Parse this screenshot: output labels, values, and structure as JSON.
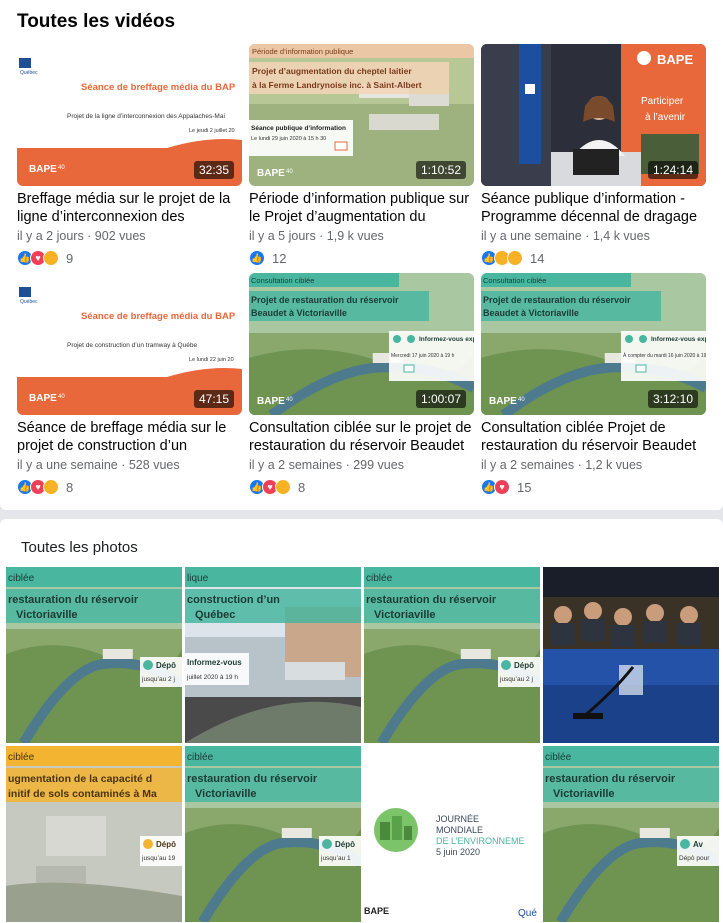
{
  "videos_section": {
    "title": "Toutes les vidéos"
  },
  "videos": [
    {
      "thumb": "briefing",
      "thumb_title": "Séance de breffage média du BAP",
      "thumb_sub": "Projet de la ligne d’interconnexion des Appalaches-Mai",
      "thumb_date": "Le jeudi 2 juillet 20",
      "duration": "32:35",
      "title": "Breffage média sur le projet de la ligne d’interconnexion des Appalaches-…",
      "meta": "il y a 2 jours · 902 vues",
      "reactions": [
        "like",
        "love",
        "care"
      ],
      "count": "9"
    },
    {
      "thumb": "farm",
      "thumb_banner": "Période d’information publique",
      "thumb_title": "Projet d’augmentation du cheptel laitier à la Ferme Landrynoise inc. à Saint-Albert",
      "thumb_sub": "Séance publique d’information",
      "thumb_date": "Le lundi 29 juin 2020 à 15 h 30",
      "duration": "1:10:52",
      "title": "Période d’information publique sur le Projet d’augmentation du cheptel lait…",
      "meta": "il y a 5 jours · 1,9 k vues",
      "reactions": [
        "like"
      ],
      "count": "12"
    },
    {
      "thumb": "speaker",
      "thumb_brand": "BAPE",
      "thumb_title": "Participer à l’avenir",
      "duration": "1:24:14",
      "title": "Séance publique d’information - Programme décennal de dragage …",
      "meta": "il y a une semaine · 1,4 k vues",
      "reactions": [
        "like",
        "care",
        "sad"
      ],
      "count": "14"
    },
    {
      "thumb": "briefing",
      "thumb_title": "Séance de breffage média du BAP",
      "thumb_sub": "Projet de construction d’un tramway à Québe",
      "thumb_date": "Le lundi 22 juin 20",
      "duration": "47:15",
      "title": "Séance de breffage média sur le projet de construction d’un tramway à …",
      "meta": "il y a une semaine · 528 vues",
      "reactions": [
        "like",
        "love",
        "care"
      ],
      "count": "8"
    },
    {
      "thumb": "river",
      "thumb_banner": "Consultation ciblée",
      "thumb_title": "Projet de restauration du réservoir Beaudet à Victoriaville",
      "thumb_box": "Informez-vous exprimez-vo",
      "thumb_date": "Mercredi 17 juin 2020 à 19 h",
      "duration": "1:00:07",
      "title": "Consultation ciblée sur le projet de restauration du réservoir Beaudet à …",
      "meta": "il y a 2 semaines · 299 vues",
      "reactions": [
        "like",
        "love",
        "wow"
      ],
      "count": "8"
    },
    {
      "thumb": "river",
      "thumb_banner": "Consultation ciblée",
      "thumb_title": "Projet de restauration du réservoir Beaudet à Victoriaville",
      "thumb_box": "Informez-vous exprimez-vo",
      "thumb_date": "À compter du mardi 16 juin 2020 à 19 h",
      "duration": "3:12:10",
      "title": "Consultation ciblée Projet de restauration du réservoir Beaudet à …",
      "meta": "il y a 2 semaines · 1,2 k vues",
      "reactions": [
        "like",
        "love"
      ],
      "count": "15"
    }
  ],
  "photos_section": {
    "title": "Toutes les photos"
  },
  "photos": [
    {
      "kind": "river",
      "tag": "ciblée",
      "title": "restauration du réservoir Victoriaville",
      "box": "Dépô",
      "box_sub": "jusqu’au 2 j"
    },
    {
      "kind": "tram",
      "tag": "lique",
      "title": "construction d’un Québec",
      "box": "Informez-vous",
      "box_sub": "juillet 2020 à 19 h"
    },
    {
      "kind": "river",
      "tag": "ciblée",
      "title": "restauration du réservoir Victoriaville",
      "box": "Dépô",
      "box_sub": "jusqu’au 2 j"
    },
    {
      "kind": "meeting"
    },
    {
      "kind": "soil",
      "tag": "ciblée",
      "title": "augmentation de la capacité d initif de sols contaminés à Ma",
      "box": "Dépô",
      "box_sub": "jusqu’au 19"
    },
    {
      "kind": "river",
      "tag": "ciblée",
      "title": "restauration du réservoir Victoriaville",
      "box": "Dépô",
      "box_sub": "jusqu’au 1"
    },
    {
      "kind": "env",
      "line1": "JOURNÉE",
      "line2": "MONDIALE",
      "line3": "DE L’ENVIRONNEME",
      "line4": "5 juin 2020",
      "brand": "BAPE",
      "brand2": "Qué"
    },
    {
      "kind": "river",
      "tag": "ciblée",
      "title": "restauration du réservoir Victoriaville",
      "box": "Av",
      "box_sub": "Dépô pour"
    }
  ],
  "colors": {
    "bape_orange": "#e8683b",
    "consult_green": "#49b6a0",
    "like_blue": "#1877f2",
    "love_red": "#f33e58"
  }
}
